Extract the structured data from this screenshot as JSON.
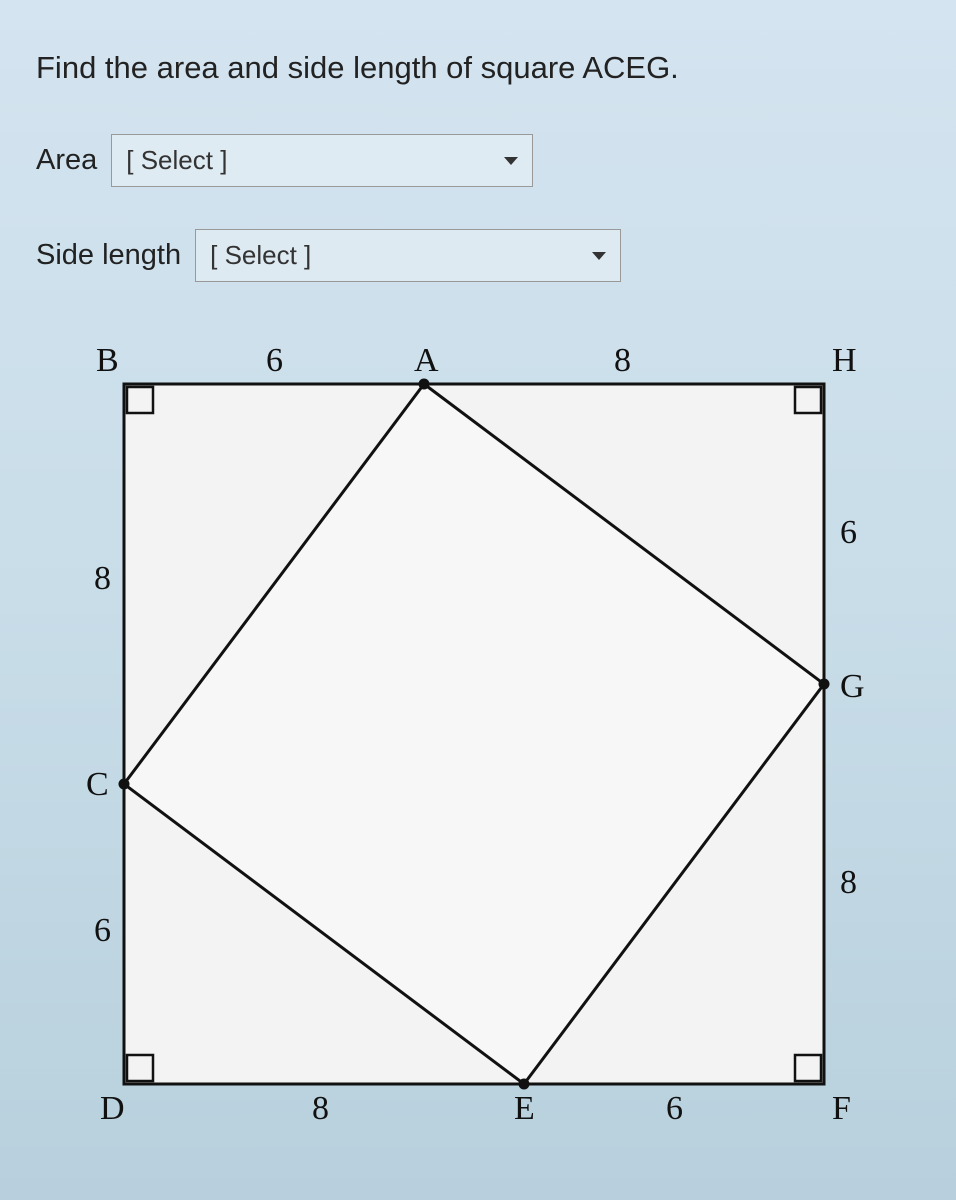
{
  "prompt": "Find the area and side length of square ACEG.",
  "fields": {
    "area": {
      "label": "Area",
      "placeholder": "[ Select ]"
    },
    "side_length": {
      "label": "Side length",
      "placeholder": "[ Select ]"
    }
  },
  "diagram": {
    "vertices": {
      "B": "B",
      "A": "A",
      "H": "H",
      "C": "C",
      "G": "G",
      "D": "D",
      "E": "E",
      "F": "F"
    },
    "segments": {
      "BA": "6",
      "AH": "8",
      "BC": "8",
      "CD": "6",
      "HG": "6",
      "GF": "8",
      "DE": "8",
      "EF": "6"
    }
  }
}
